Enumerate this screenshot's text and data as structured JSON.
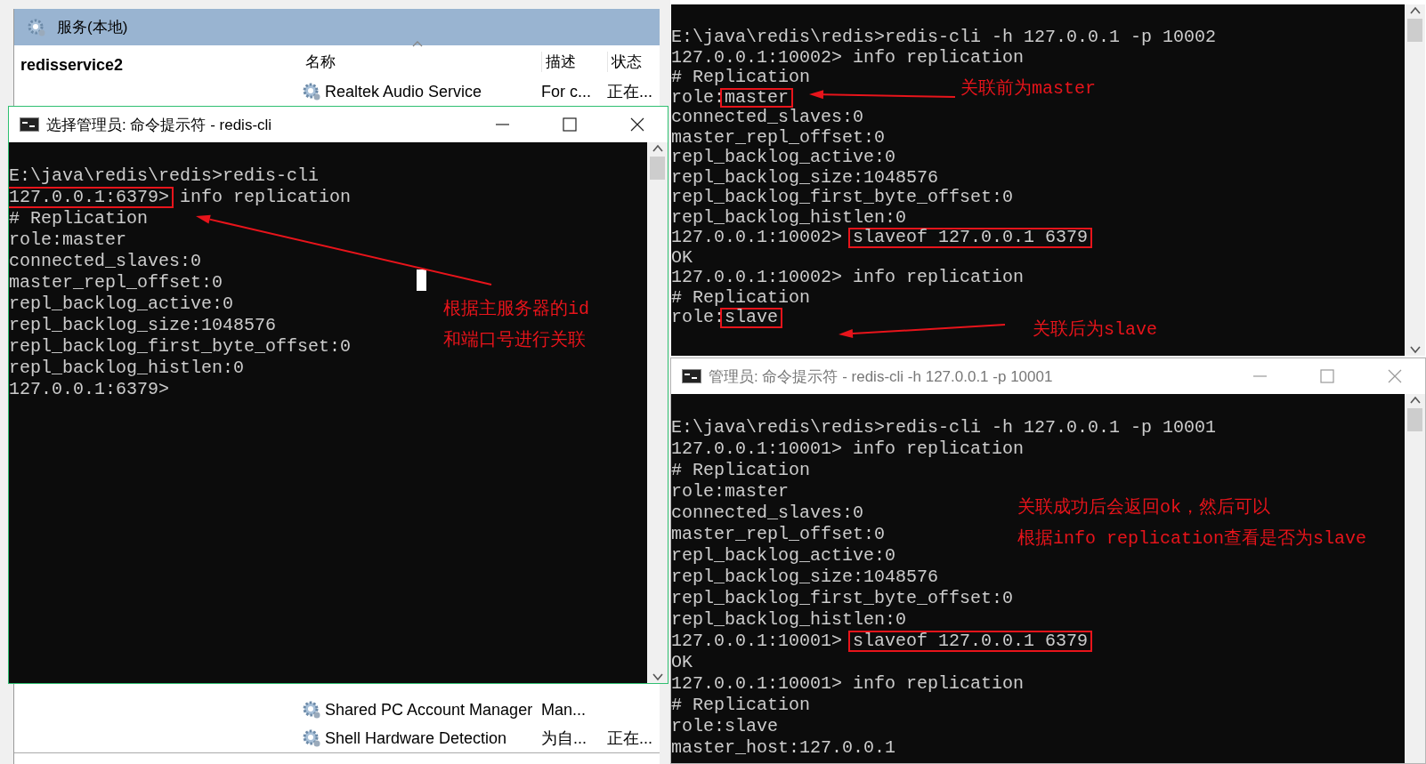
{
  "services": {
    "title": "服务(本地)",
    "selected_service": "redisservice2",
    "columns": [
      {
        "label": "名称",
        "sorted": true
      },
      {
        "label": "描述",
        "sorted": false
      },
      {
        "label": "状态",
        "sorted": false
      }
    ],
    "rows": [
      {
        "name": "Realtek Audio Service",
        "description": "For c...",
        "status": "正在..."
      },
      {
        "name": "Shared PC Account Manager",
        "description": "Man..."
      },
      {
        "name": "Shell Hardware Detection",
        "description": "为自...",
        "status": "正在..."
      }
    ]
  },
  "terminals": [
    {
      "title": "选择管理员: 命令提示符 - redis-cli",
      "active": true,
      "cursor": true,
      "lines": [
        {
          "text": "E:\\java\\redis\\redis>redis-cli"
        },
        {
          "segments": [
            {
              "text": "127.0.0.1:6379>",
              "boxed": true
            },
            {
              "text": " info replication",
              "boxed": false
            }
          ]
        },
        {
          "text": "# Replication"
        },
        {
          "text": "role:master"
        },
        {
          "text": "connected_slaves:0"
        },
        {
          "text": "master_repl_offset:0"
        },
        {
          "text": "repl_backlog_active:0"
        },
        {
          "text": "repl_backlog_size:1048576"
        },
        {
          "text": "repl_backlog_first_byte_offset:0"
        },
        {
          "text": "repl_backlog_histlen:0"
        },
        {
          "text": "127.0.0.1:6379>"
        }
      ]
    },
    {
      "lines": [
        {
          "text": "E:\\java\\redis\\redis>redis-cli -h 127.0.0.1 -p 10002"
        },
        {
          "text": "127.0.0.1:10002> info replication"
        },
        {
          "text": "# Replication"
        },
        {
          "segments": [
            {
              "text": "role:",
              "boxed": false
            },
            {
              "text": "master",
              "boxed": true
            }
          ]
        },
        {
          "text": "connected_slaves:0"
        },
        {
          "text": "master_repl_offset:0"
        },
        {
          "text": "repl_backlog_active:0"
        },
        {
          "text": "repl_backlog_size:1048576"
        },
        {
          "text": "repl_backlog_first_byte_offset:0"
        },
        {
          "text": "repl_backlog_histlen:0"
        },
        {
          "segments": [
            {
              "text": "127.0.0.1:10002> ",
              "boxed": false
            },
            {
              "text": "slaveof 127.0.0.1 6379",
              "boxed": true
            }
          ]
        },
        {
          "text": "OK"
        },
        {
          "text": "127.0.0.1:10002> info replication"
        },
        {
          "text": "# Replication"
        },
        {
          "segments": [
            {
              "text": "role:",
              "boxed": false
            },
            {
              "text": "slave",
              "boxed": true
            }
          ]
        }
      ]
    },
    {
      "title": "管理员: 命令提示符 - redis-cli  -h 127.0.0.1 -p 10001",
      "active": false,
      "lines": [
        {
          "text": "E:\\java\\redis\\redis>redis-cli -h 127.0.0.1 -p 10001"
        },
        {
          "text": "127.0.0.1:10001> info replication"
        },
        {
          "text": "# Replication"
        },
        {
          "text": "role:master"
        },
        {
          "text": "connected_slaves:0"
        },
        {
          "text": "master_repl_offset:0"
        },
        {
          "text": "repl_backlog_active:0"
        },
        {
          "text": "repl_backlog_size:1048576"
        },
        {
          "text": "repl_backlog_first_byte_offset:0"
        },
        {
          "text": "repl_backlog_histlen:0"
        },
        {
          "segments": [
            {
              "text": "127.0.0.1:10001> ",
              "boxed": false
            },
            {
              "text": "slaveof 127.0.0.1 6379",
              "boxed": true
            }
          ]
        },
        {
          "text": "OK"
        },
        {
          "text": "127.0.0.1:10001> info replication"
        },
        {
          "text": "# Replication"
        },
        {
          "text": "role:slave"
        },
        {
          "text": "master_host:127.0.0.1"
        }
      ]
    }
  ],
  "annotations": [
    {
      "lines": [
        "根据主服务器的id",
        "和端口号进行关联"
      ]
    },
    {
      "lines": [
        "关联前为master"
      ]
    },
    {
      "lines": [
        "关联后为slave"
      ]
    },
    {
      "lines": [
        "关联成功后会返回ok，然后可以",
        "根据info replication查看是否为slave"
      ]
    }
  ]
}
